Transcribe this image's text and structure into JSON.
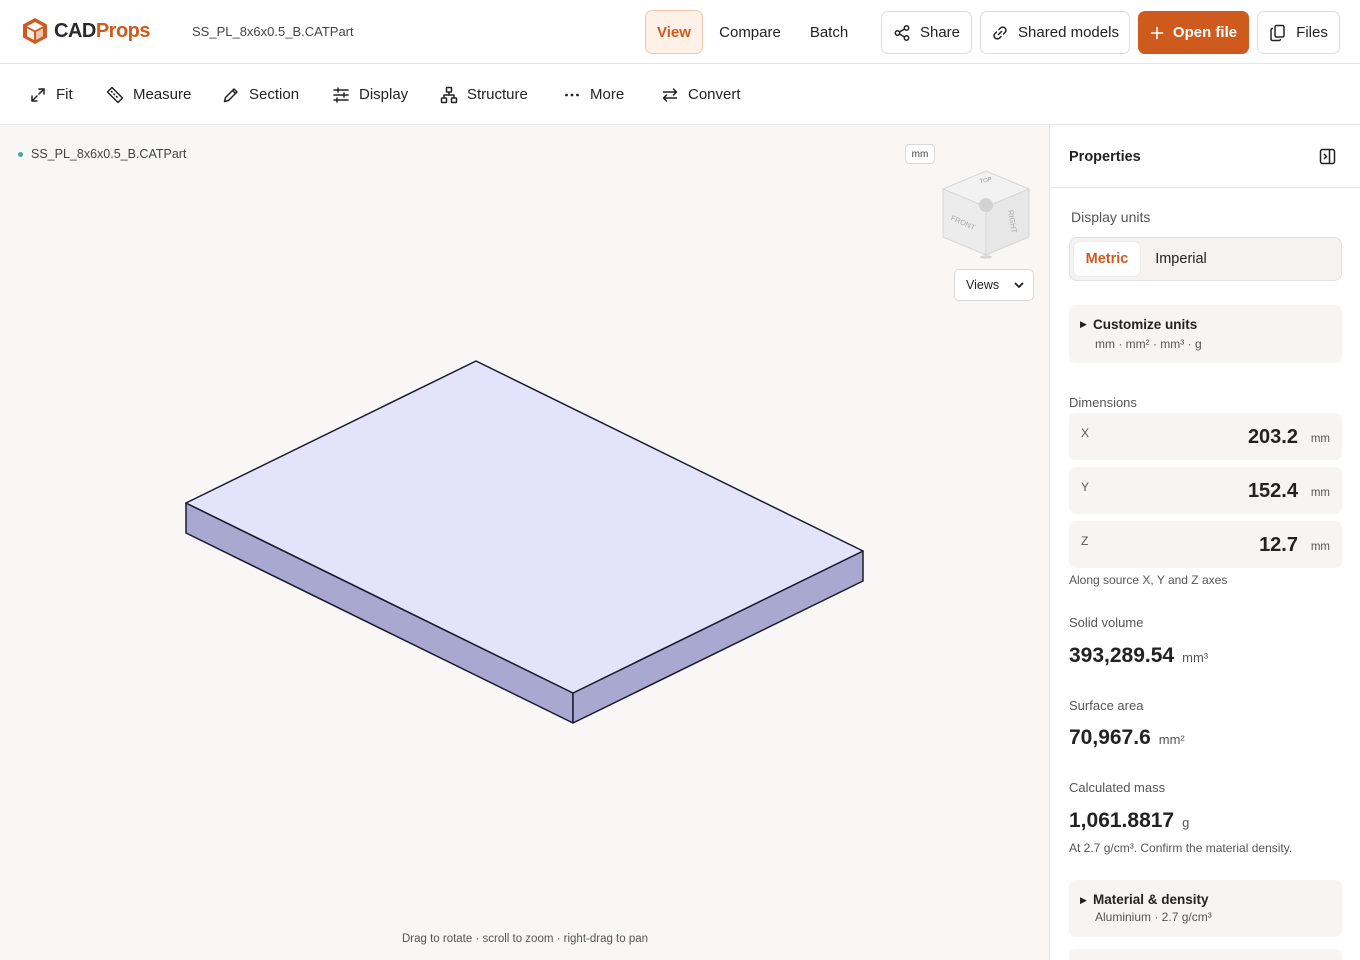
{
  "header": {
    "logo_text_a": "CAD",
    "logo_text_b": "Props",
    "filename": "SS_PL_8x6x0.5_B.CATPart",
    "nav": {
      "view": "View",
      "compare": "Compare",
      "batch": "Batch",
      "active": "View"
    },
    "buttons": {
      "share": "Share",
      "shared_models": "Shared models",
      "open_file": "Open file",
      "files": "Files"
    }
  },
  "toolbar": {
    "fit": "Fit",
    "measure": "Measure",
    "section": "Section",
    "display": "Display",
    "structure": "Structure",
    "more": "More",
    "convert": "Convert"
  },
  "viewport": {
    "model_name": "SS_PL_8x6x0.5_B.CATPart",
    "unit_chip": "mm",
    "cube_faces": {
      "front": "FRONT",
      "right": "RIGHT",
      "top": "TOP"
    },
    "views_select": "Views",
    "hint": "Drag to rotate · scroll to zoom · right-drag to pan"
  },
  "panel": {
    "title": "Properties",
    "display_units_label": "Display units",
    "units": {
      "metric": "Metric",
      "imperial": "Imperial",
      "selected": "Metric"
    },
    "customize": {
      "title": "Customize units",
      "summary": "mm · mm² · mm³ · g"
    },
    "dimensions_label": "Dimensions",
    "dimensions": [
      {
        "axis": "X",
        "value": "203.2",
        "unit": "mm"
      },
      {
        "axis": "Y",
        "value": "152.4",
        "unit": "mm"
      },
      {
        "axis": "Z",
        "value": "12.7",
        "unit": "mm"
      }
    ],
    "dimensions_note": "Along source X, Y and Z axes",
    "volume": {
      "label": "Solid volume",
      "value": "393,289.54",
      "unit": "mm³"
    },
    "area": {
      "label": "Surface area",
      "value": "70,967.6",
      "unit": "mm²"
    },
    "mass": {
      "label": "Calculated mass",
      "value": "1,061.8817",
      "unit": "g",
      "note": "At 2.7 g/cm³. Confirm the material density."
    },
    "material": {
      "title": "Material & density",
      "summary": "Aluminium · 2.7 g/cm³"
    }
  },
  "colors": {
    "brand": "#cf5a1e",
    "model_top": "#e3e3fb",
    "model_side": "#a9a8d0",
    "status_dot": "#4aa89a"
  }
}
